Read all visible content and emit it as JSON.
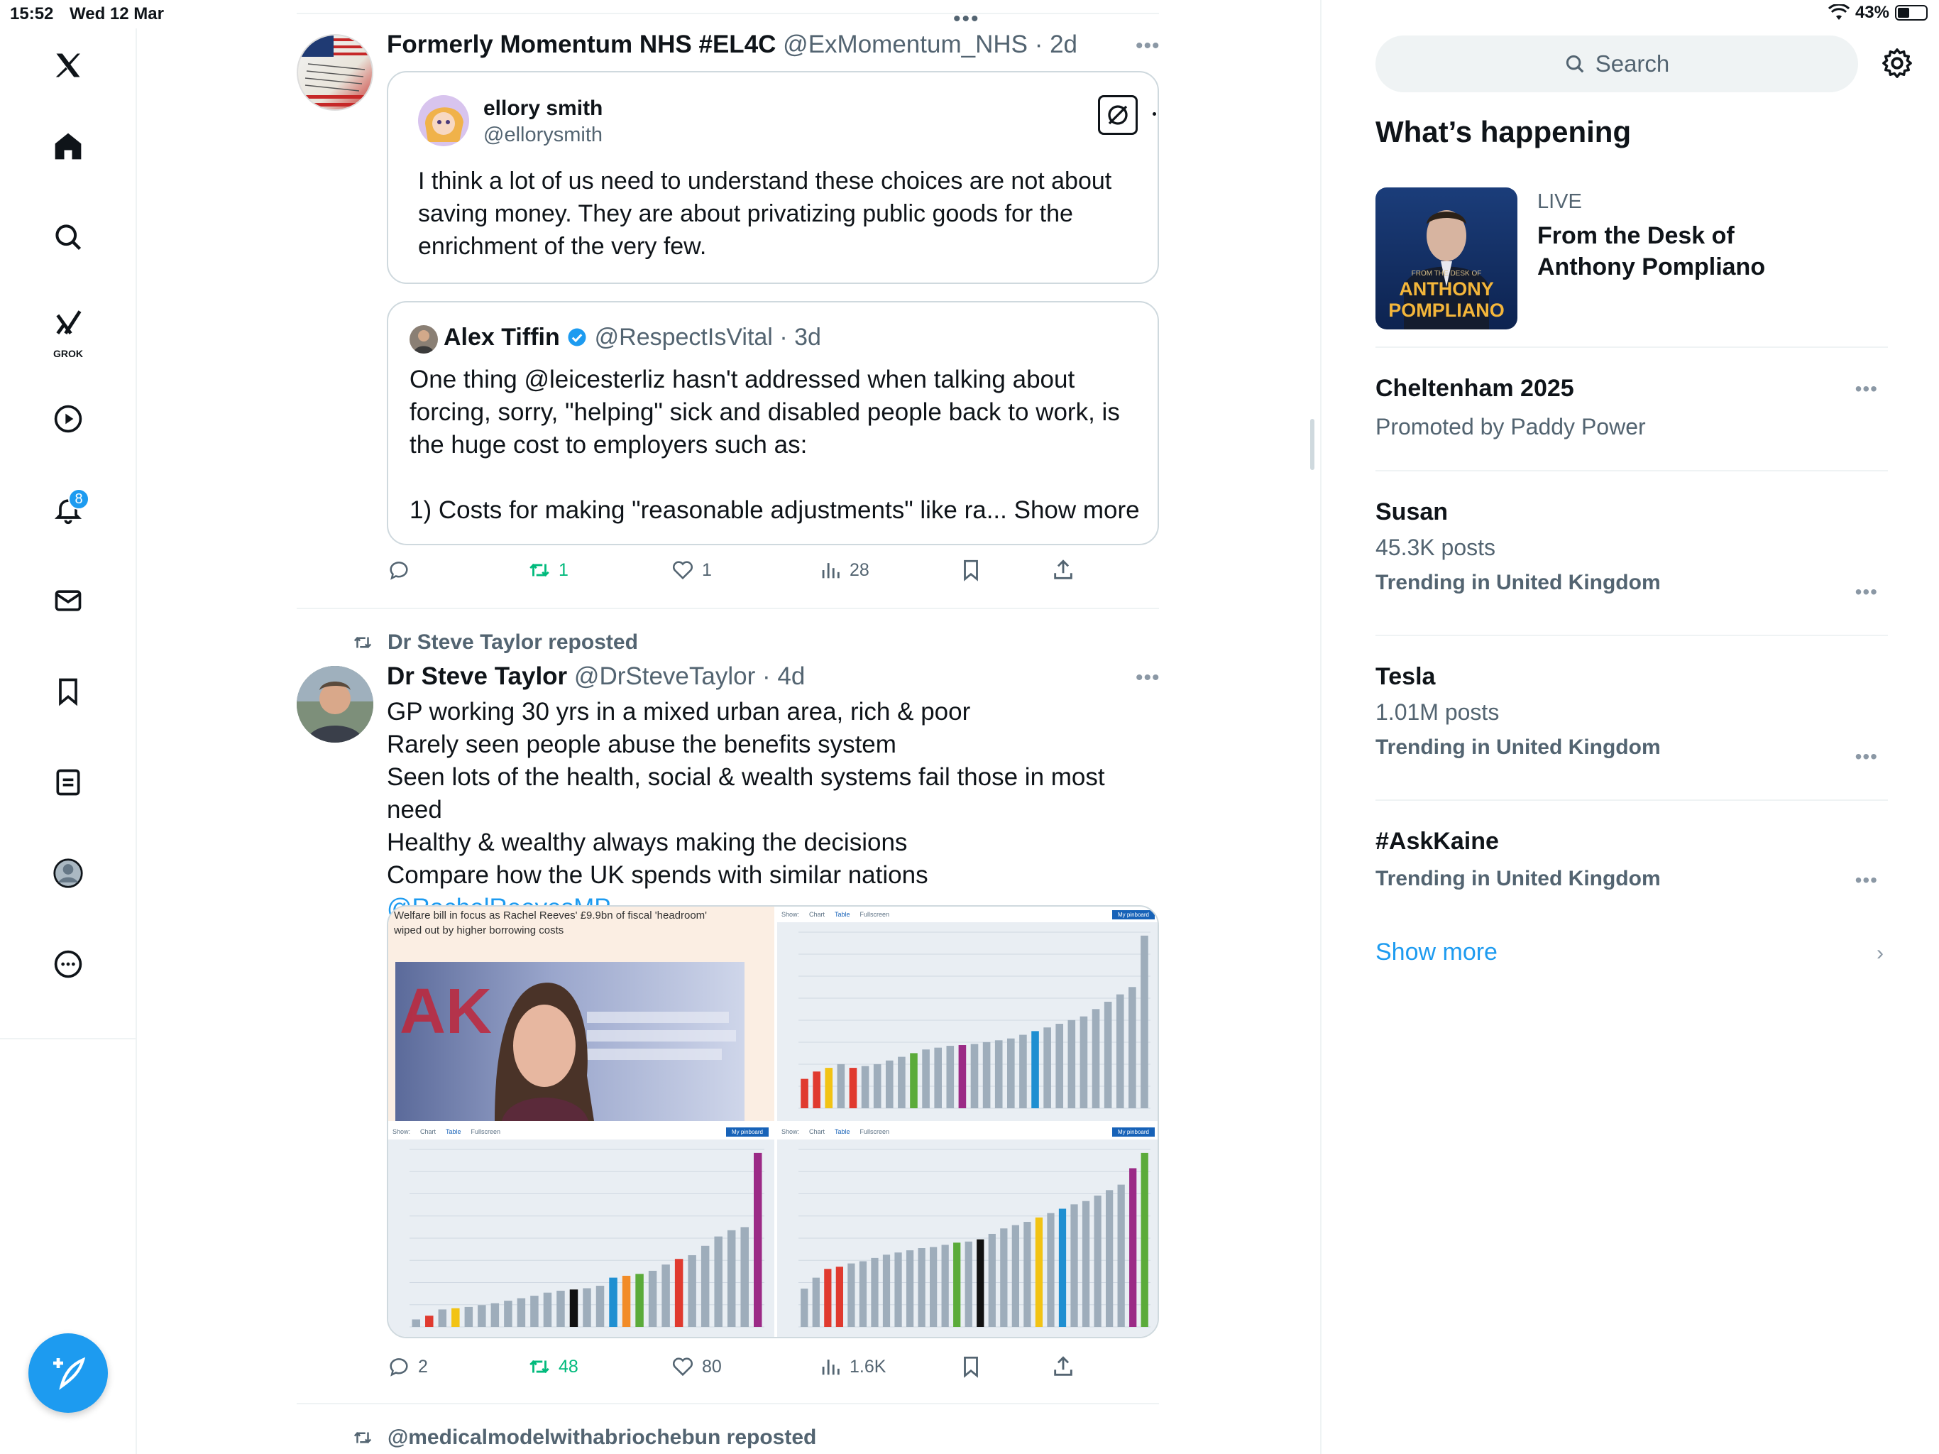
{
  "status_bar": {
    "time": "15:52",
    "date": "Wed 12 Mar",
    "battery": "43%",
    "battery_level": 0.43
  },
  "nav": {
    "grok_label": "GROK",
    "notifications_count": "8"
  },
  "tweet1": {
    "author": "Formerly Momentum NHS #EL4C",
    "handle": "@ExMomentum_NHS",
    "time": "· 2d",
    "quote": {
      "author": "ellory smith",
      "handle": "@ellorysmith",
      "text": "I think a lot of us need to understand these choices are not about saving money. They are about privatizing public goods for the enrichment of the very few."
    },
    "quote2": {
      "author": "Alex Tiffin",
      "handle": "@RespectIsVital",
      "time": "· 3d",
      "text_line1": "One thing @leicesterliz hasn't addressed when talking about",
      "text_line2": "forcing, sorry, \"helping\" sick and disabled people back to work, is",
      "text_line3": "the huge cost to employers such as:",
      "text_line4": "1) Costs for making \"reasonable adjustments\" like ra...",
      "show_more": "Show more"
    },
    "actions": {
      "replies": "",
      "reposts": "1",
      "likes": "1",
      "views": "28"
    }
  },
  "tweet2": {
    "repost_by": "Dr Steve Taylor reposted",
    "author": "Dr Steve Taylor",
    "handle": "@DrSteveTaylor",
    "time": "· 4d",
    "lines": [
      "GP working 30 yrs in a mixed urban area, rich & poor",
      "Rarely seen people abuse the benefits system",
      "Seen lots of the health, social & wealth systems fail those in most need",
      "Healthy & wealthy always making the decisions",
      "Compare how the UK spends with similar nations"
    ],
    "mention": "@RachelReevesMP",
    "news_headline": "Welfare bill in focus as Rachel Reeves' £9.9bn of fiscal 'headroom' wiped out by higher borrowing costs",
    "actions": {
      "replies": "2",
      "reposts": "48",
      "likes": "80",
      "views": "1.6K"
    }
  },
  "tweet3": {
    "repost_by": "@medicalmodelwithabriochebun reposted"
  },
  "chart_toolbar": {
    "show": "Show:",
    "chart": "Chart",
    "table": "Table",
    "fullscreen": "Fullscreen",
    "pinboard": "My pinboard"
  },
  "right": {
    "search_placeholder": "Search",
    "whats_happening": "What’s happening",
    "live": {
      "tag": "LIVE",
      "title_line1": "From the Desk of",
      "title_line2": "Anthony Pompliano",
      "thumb_small": "FROM THE DESK OF",
      "thumb_big1": "ANTHONY",
      "thumb_big2": "POMPLIANO"
    },
    "trends": [
      {
        "name": "Cheltenham 2025",
        "meta": "Promoted by Paddy Power"
      },
      {
        "name": "Susan",
        "meta": "45.3K posts",
        "loc": "Trending in United Kingdom"
      },
      {
        "name": "Tesla",
        "meta": "1.01M posts",
        "loc": "Trending in United Kingdom"
      },
      {
        "name": "#AskKaine",
        "loc": "Trending in United Kingdom"
      }
    ],
    "show_more": "Show more"
  },
  "colors": {
    "accent": "#1d9bf0",
    "repost_green": "#00ba7c",
    "bar_grey": "#9eadbb",
    "bar_red": "#e03a2f",
    "bar_orange": "#f28c28",
    "bar_yellow": "#f2c314",
    "bar_green": "#5bab3a",
    "bar_purple": "#9b2a86",
    "bar_blue": "#1f8fd1"
  },
  "chart_data": [
    {
      "type": "bar",
      "title": "",
      "note": "country comparison chart (values approximate, unlabeled)",
      "values": [
        0.8,
        1.0,
        1.1,
        1.2,
        1.1,
        1.15,
        1.2,
        1.3,
        1.4,
        1.5,
        1.6,
        1.65,
        1.7,
        1.72,
        1.75,
        1.8,
        1.85,
        1.9,
        2.0,
        2.1,
        2.2,
        2.3,
        2.4,
        2.5,
        2.7,
        2.9,
        3.1,
        3.3,
        4.7
      ],
      "highlight": {
        "0": "red",
        "1": "red",
        "2": "yellow",
        "4": "red",
        "9": "green",
        "13": "purple",
        "19": "blue"
      }
    },
    {
      "type": "bar",
      "title": "",
      "note": "country comparison chart (values approximate)",
      "values": [
        0.12,
        0.18,
        0.28,
        0.3,
        0.32,
        0.35,
        0.38,
        0.42,
        0.46,
        0.5,
        0.55,
        0.58,
        0.6,
        0.62,
        0.66,
        0.79,
        0.82,
        0.85,
        0.9,
        1.0,
        1.09,
        1.15,
        1.3,
        1.45,
        1.55,
        1.6,
        2.79
      ],
      "highlight": {
        "1": "red",
        "3": "yellow",
        "12": "black",
        "15": "blue",
        "16": "orange",
        "17": "green",
        "20": "red",
        "26": "purple"
      }
    },
    {
      "type": "bar",
      "title": "",
      "note": "country comparison chart (values approximate)",
      "values": [
        3.5,
        4.5,
        5.3,
        5.5,
        5.8,
        6.0,
        6.3,
        6.6,
        6.8,
        7.0,
        7.2,
        7.3,
        7.5,
        7.7,
        7.8,
        8.0,
        8.5,
        9.0,
        9.3,
        9.6,
        10.0,
        10.4,
        10.8,
        11.2,
        11.5,
        12.0,
        12.5,
        13.0,
        14.5,
        15.9
      ],
      "highlight": {
        "2": "red",
        "3": "red",
        "13": "green",
        "15": "black",
        "20": "yellow",
        "22": "blue",
        "28": "purple",
        "29": "green"
      }
    }
  ]
}
